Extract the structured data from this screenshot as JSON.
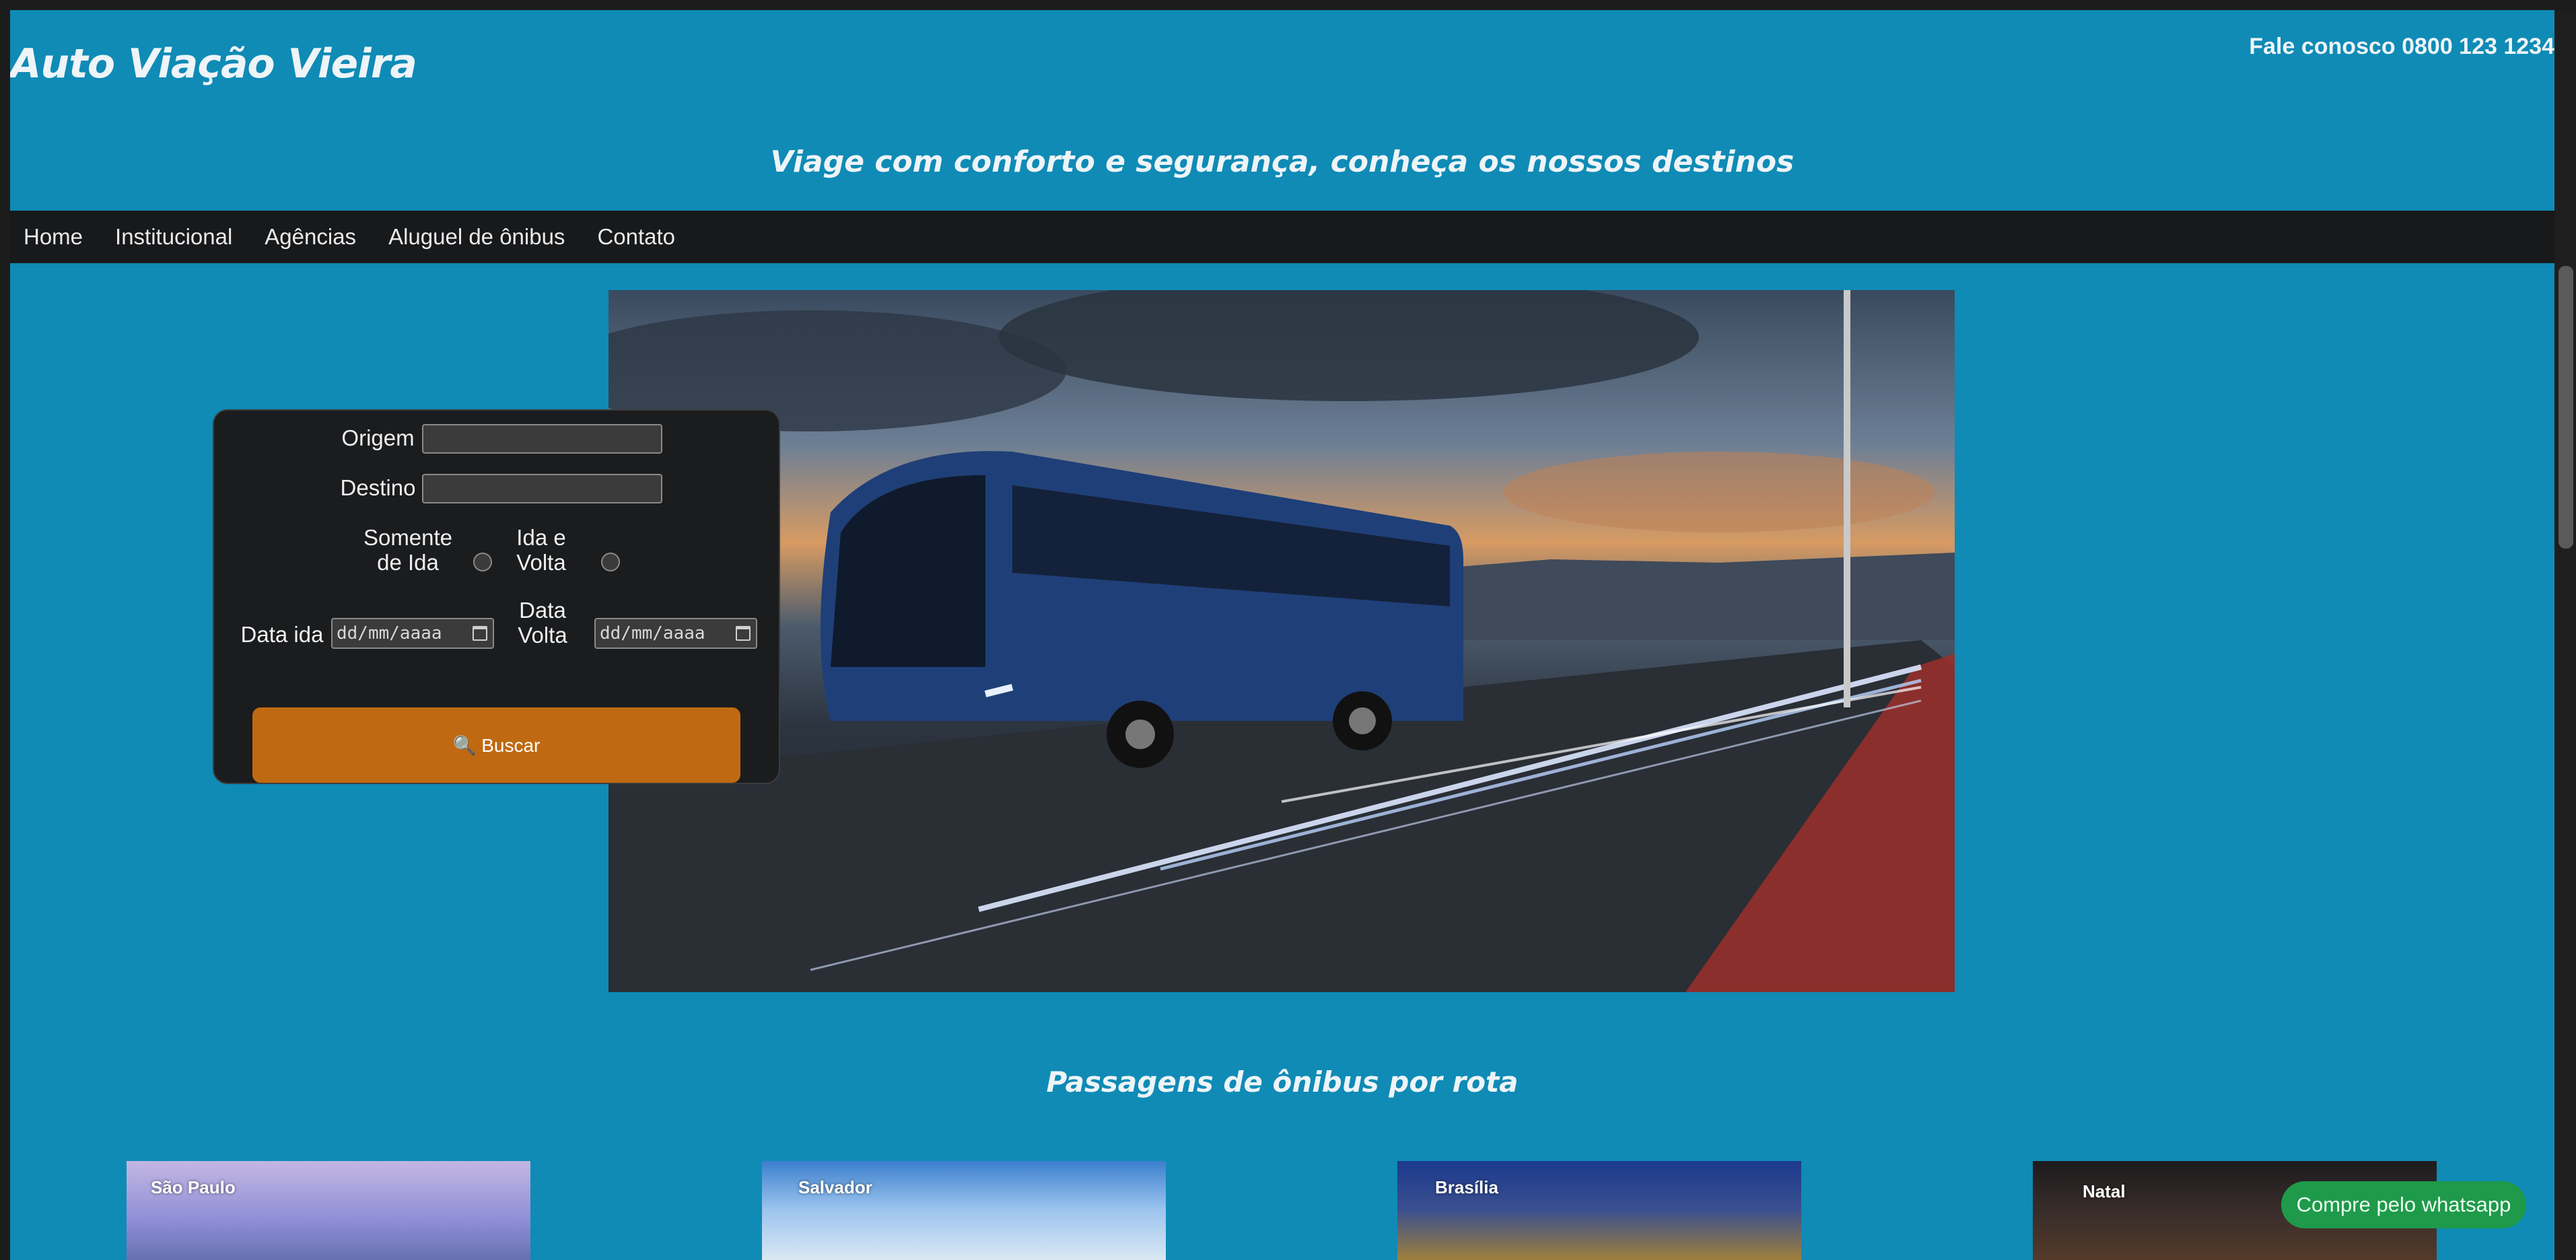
{
  "header": {
    "brand": "Auto Viação Vieira",
    "contact": "Fale conosco 0800 123 1234",
    "tagline": "Viage com conforto e segurança, conheça os nossos destinos"
  },
  "nav": {
    "items": [
      "Home",
      "Institucional",
      "Agências",
      "Aluguel de ônibus",
      "Contato"
    ]
  },
  "search": {
    "origem_label": "Origem",
    "destino_label": "Destino",
    "somente_ida_label": "Somente de Ida",
    "ida_volta_label": "Ida e Volta",
    "data_ida_label": "Data ida",
    "data_volta_label": "Data Volta",
    "date_placeholder": "dd/mm/aaaa",
    "buscar_label": "🔍 Buscar"
  },
  "routes": {
    "title": "Passagens de ônibus por rota",
    "cities": [
      "São Paulo",
      "Salvador",
      "Brasília",
      "Natal"
    ]
  },
  "whatsapp_label": "Compre pelo whatsapp",
  "colors": {
    "page_bg": "#0f8bb6",
    "nav_bg": "#18191b",
    "button_orange": "#bf6a12",
    "whatsapp_green": "#1f9a4a"
  }
}
